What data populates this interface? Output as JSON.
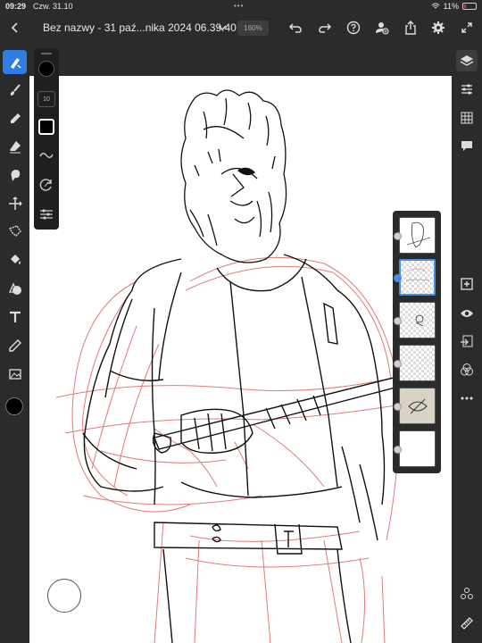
{
  "status": {
    "time": "09:29",
    "date": "Czw. 31.10",
    "dots": "•••",
    "battery": "11%"
  },
  "header": {
    "document_title": "Bez nazwy - 31 paź...nika 2024 06.39.40 *",
    "zoom": "160%"
  },
  "brush_panel": {
    "size": "10"
  },
  "colors": {
    "accent": "#2f7de1",
    "selection_blue": "#4a90e2",
    "sketch_red": "#e07a7a",
    "ink": "#111111"
  },
  "left_tools": [
    "brush-select",
    "paint-brush",
    "pixel-brush",
    "eraser",
    "smudge",
    "transform",
    "lasso",
    "fill",
    "shape",
    "text",
    "eyedropper",
    "image"
  ],
  "right_tools": [
    "layers",
    "properties",
    "grid",
    "comments",
    "add-layer",
    "visibility",
    "import",
    "blend",
    "more",
    "share",
    "ruler"
  ],
  "layers": [
    {
      "name": "layer-1",
      "visible": true
    },
    {
      "name": "layer-2",
      "visible": true,
      "selected": true
    },
    {
      "name": "layer-3",
      "visible": true
    },
    {
      "name": "layer-4",
      "visible": true
    },
    {
      "name": "layer-5",
      "visible": true
    },
    {
      "name": "layer-6",
      "visible": true
    }
  ]
}
